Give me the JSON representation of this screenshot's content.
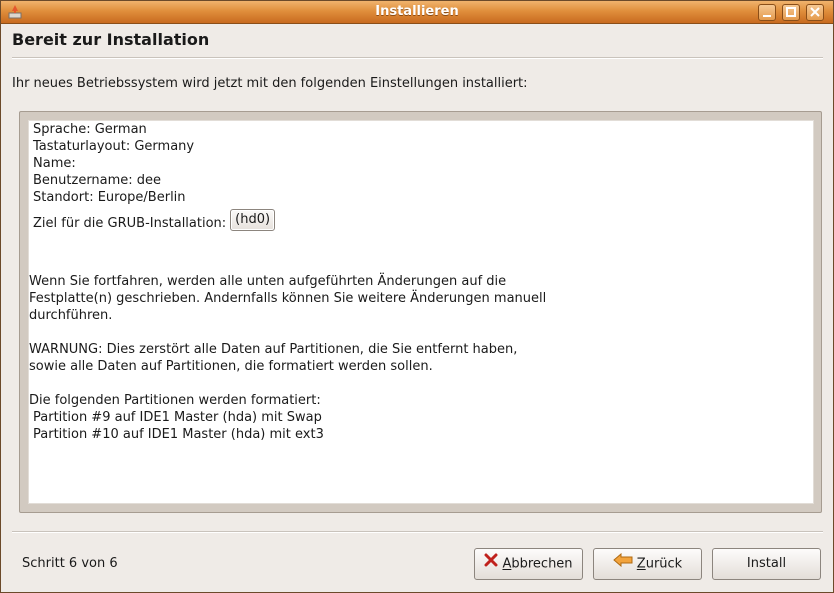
{
  "window": {
    "title": "Installieren"
  },
  "header": {
    "title": "Bereit zur Installation",
    "intro": "Ihr neues Betriebssystem wird jetzt mit den folgenden Einstellungen installiert:"
  },
  "summary": {
    "settings": [
      "Sprache: German",
      "Tastaturlayout: Germany",
      "Name:",
      "Benutzername: dee",
      "Standort: Europe/Berlin"
    ],
    "grub_label": "Ziel für die GRUB-Installation:",
    "grub_value": "(hd0)",
    "warning_lines": [
      "Wenn Sie fortfahren, werden alle unten aufgeführten Änderungen auf die",
      "Festplatte(n) geschrieben. Andernfalls können Sie weitere Änderungen manuell",
      "durchführen.",
      "",
      "WARNUNG: Dies zerstört alle Daten auf Partitionen, die Sie entfernt haben,",
      "sowie alle Daten auf Partitionen, die formatiert werden sollen.",
      "",
      "Die folgenden Partitionen werden formatiert:",
      " Partition #9 auf IDE1 Master (hda) mit Swap",
      " Partition #10 auf IDE1 Master (hda) mit ext3"
    ]
  },
  "footer": {
    "step": "Schritt 6 von 6",
    "cancel_first": "A",
    "cancel_rest": "bbrechen",
    "back_first": "Z",
    "back_rest": "urück",
    "install": "Install"
  },
  "icons": {
    "cancel": "x-icon",
    "back": "arrow-left-icon",
    "app": "installer-icon"
  },
  "colors": {
    "titlebar": "#e08f3c",
    "background": "#efebe7"
  }
}
